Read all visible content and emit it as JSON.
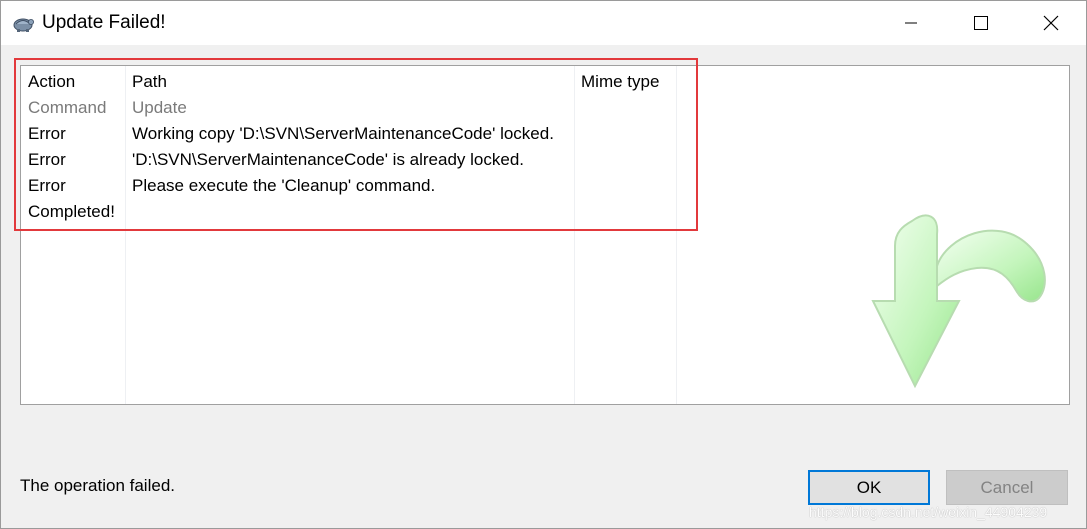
{
  "window": {
    "title": "Update Failed!"
  },
  "list": {
    "columns": {
      "action": "Action",
      "path": "Path",
      "mime": "Mime type"
    },
    "rows": [
      {
        "action": "Command",
        "path": "Update"
      },
      {
        "action": "Error",
        "path": "Working copy 'D:\\SVN\\ServerMaintenanceCode' locked."
      },
      {
        "action": "Error",
        "path": "'D:\\SVN\\ServerMaintenanceCode' is already locked."
      },
      {
        "action": "Error",
        "path": "Please execute the 'Cleanup' command."
      },
      {
        "action": "Completed!",
        "path": ""
      }
    ]
  },
  "status": "The operation failed.",
  "buttons": {
    "ok": "OK",
    "cancel": "Cancel"
  },
  "watermark": "https://blog.csdn.net/weixin_44904239",
  "colors": {
    "highlight": "#e2393c",
    "ok_border": "#0078d7",
    "arrow": "#b8f5b0"
  },
  "icons": {
    "app": "tortoise-icon",
    "status_image": "update-arrow-icon"
  }
}
